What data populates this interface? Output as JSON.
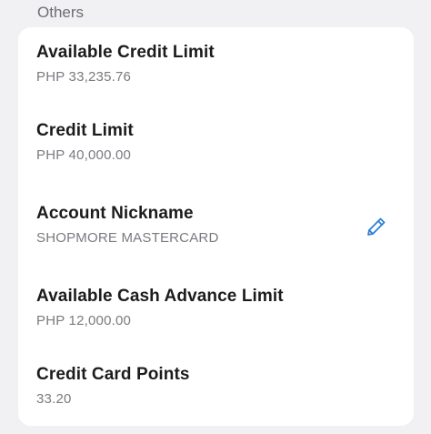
{
  "section": {
    "title": "Others"
  },
  "items": [
    {
      "label": "Available Credit Limit",
      "value": "PHP 33,235.76"
    },
    {
      "label": "Credit Limit",
      "value": "PHP 40,000.00"
    },
    {
      "label": "Account Nickname",
      "value": "SHOPMORE MASTERCARD",
      "action_icon": "pencil-icon"
    },
    {
      "label": "Available Cash Advance Limit",
      "value": "PHP 12,000.00"
    },
    {
      "label": "Credit Card Points",
      "value": "33.20"
    }
  ],
  "colors": {
    "background": "#f1f1f3",
    "card": "#ffffff",
    "label": "#1c1c1e",
    "value": "#7a7a80",
    "accent": "#2f7fd6"
  }
}
